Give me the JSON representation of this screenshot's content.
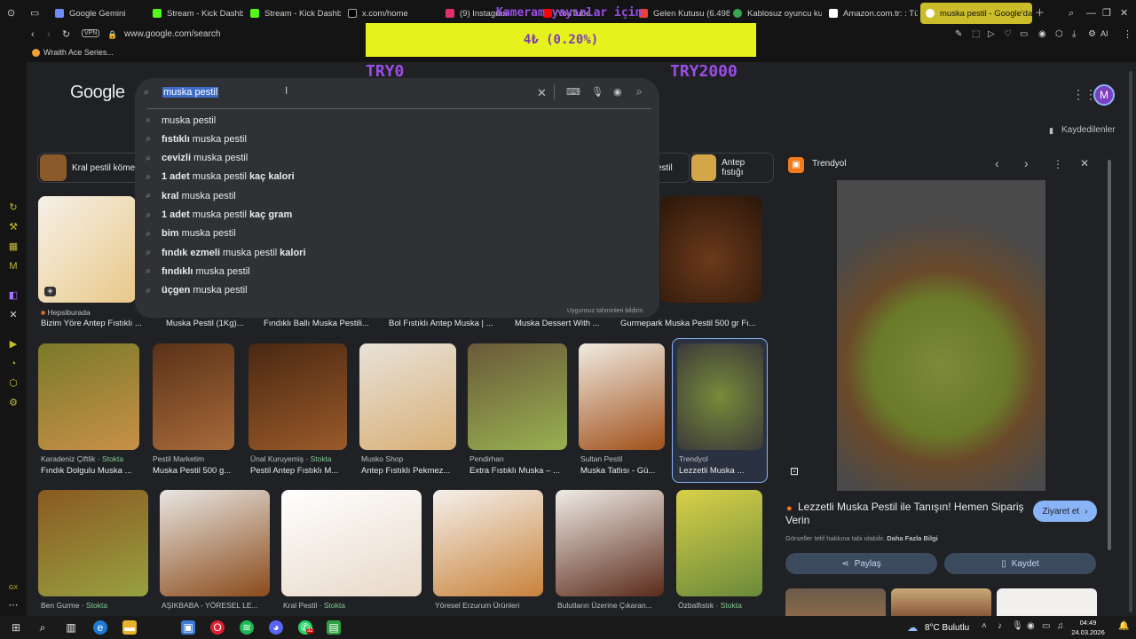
{
  "tabs": [
    {
      "label": "Google Gemini"
    },
    {
      "label": "Stream - Kick Dashb"
    },
    {
      "label": "Stream - Kick Dashb"
    },
    {
      "label": "x.com/home"
    },
    {
      "label": "(9) Instagram"
    },
    {
      "label": "YouTube"
    },
    {
      "label": "Gelen Kutusu (6.498)"
    },
    {
      "label": "Kablosuz oyuncu ku"
    },
    {
      "label": "Amazon.com.tr: : Tüm"
    },
    {
      "label": "muska pestil - Google'da"
    }
  ],
  "address": {
    "vpn": "VPN",
    "url": "www.google.com/search",
    "ai_label": "AI"
  },
  "bookmarks": [
    "Wraith Ace Series..."
  ],
  "sidebar": {
    "gx": "GX"
  },
  "header": {
    "logo": "Google",
    "avatar_initial": "M",
    "saved": "Kaydedilenler"
  },
  "search": {
    "query": "muska pestil",
    "report": "Uygunsuz tahminleri bildirin",
    "suggestions": [
      {
        "bold_pre": "",
        "text": "muska pestil",
        "bold_post": ""
      },
      {
        "bold_pre": "fıstıklı",
        "text": "muska pestil",
        "bold_post": ""
      },
      {
        "bold_pre": "cevizli",
        "text": "muska pestil",
        "bold_post": ""
      },
      {
        "bold_pre": "1 adet",
        "text": "muska pestil",
        "bold_post": "kaç kalori"
      },
      {
        "bold_pre": "kral",
        "text": "muska pestil",
        "bold_post": ""
      },
      {
        "bold_pre": "1 adet",
        "text": "muska pestil",
        "bold_post": "kaç gram"
      },
      {
        "bold_pre": "bim",
        "text": "muska pestil",
        "bold_post": ""
      },
      {
        "bold_pre": "fındık ezmeli",
        "text": "muska pestil",
        "bold_post": "kalori"
      },
      {
        "bold_pre": "fındıklı",
        "text": "muska pestil",
        "bold_post": ""
      },
      {
        "bold_pre": "üçgen",
        "text": "muska pestil",
        "bold_post": ""
      }
    ]
  },
  "overlay": {
    "banner": "Kameram yayınlar için",
    "ticker_value": "4₺ (0.20%)",
    "min_label": "TRY0",
    "max_label": "TRY2000"
  },
  "chips": [
    "Kral pestil köme",
    "estil",
    "Antep fıstığı"
  ],
  "row1": [
    {
      "source": "Hepsiburada",
      "title": "Bizim Yöre Antep Fıstıklı ..."
    },
    {
      "title": "Muska Pestil (1Kg)..."
    },
    {
      "title": "Fındıklı Ballı Muska Pestili..."
    },
    {
      "title": "Bol Fıstıklı Antep Muska | ..."
    },
    {
      "title": "Muska Dessert With ..."
    },
    {
      "title": "Gurmepark Muska Pestil 500 gr Fı..."
    }
  ],
  "row2": [
    {
      "source": "Karadeniz Çiftlik",
      "stock": "Stokta",
      "title": "Fındık Dolgulu Muska ..."
    },
    {
      "source": "Pestil Marketim",
      "title": "Muska Pestil 500 g..."
    },
    {
      "source": "Ünal Kuruyemiş",
      "stock": "Stokta",
      "title": "Pestil Antep Fıstıklı M..."
    },
    {
      "source": "Musko Shop",
      "title": "Antep Fıstıklı Pekmez..."
    },
    {
      "source": "Pendirhan",
      "title": "Extra Fıstıklı Muska – ..."
    },
    {
      "source": "Sultan Pestil",
      "title": "Muska Tatlısı - Gü..."
    },
    {
      "source": "Trendyol",
      "title": "Lezzetli Muska ..."
    }
  ],
  "row3": [
    {
      "source": "Ben Gurme",
      "stock": "Stokta"
    },
    {
      "source": "AŞIKBABA - YÖRESEL LE..."
    },
    {
      "source": "Kral Pestil",
      "stock": "Stokta"
    },
    {
      "source": "Yöresel Erzurum Ürünleri"
    },
    {
      "source": "Bulutların Üzerine Çıkaran..."
    },
    {
      "source": "Özbalfıstık",
      "stock": "Stokta"
    }
  ],
  "panel": {
    "source": "Trendyol",
    "title": "Lezzetli Muska Pestil ile Tanışın! Hemen Sipariş Verin",
    "visit": "Ziyaret et",
    "copyright": "Görseller telif hakkına tabi olabilir.",
    "more_info": "Daha Fazla Bilgi",
    "share": "Paylaş",
    "save": "Kaydet"
  },
  "taskbar": {
    "weather": "8°C  Bulutlu",
    "time": "04:49",
    "date": "24.03.2026",
    "whatsapp_badge": "32"
  }
}
